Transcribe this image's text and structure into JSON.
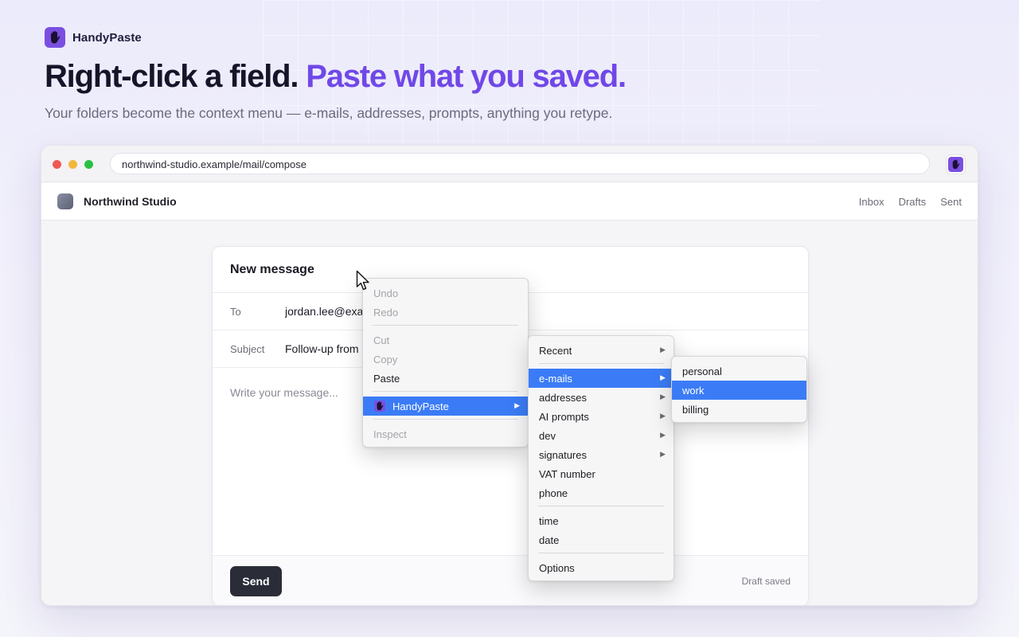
{
  "brand": {
    "name": "HandyPaste",
    "logo_icon": "hand-icon",
    "accent": "#7048e8"
  },
  "hero": {
    "headline_main": "Right-click a field.",
    "headline_accent": "Paste what you saved.",
    "subline": "Your folders become the context menu — e-mails, addresses, prompts, anything you retype."
  },
  "browser": {
    "url": "northwind-studio.example/mail/compose",
    "extension_icon": "handypaste-extension-icon"
  },
  "app": {
    "name": "Northwind Studio",
    "nav": [
      "Inbox",
      "Drafts",
      "Sent"
    ]
  },
  "compose": {
    "title": "New message",
    "to_label": "To",
    "to_value": "jordan.lee@exam",
    "subject_label": "Subject",
    "subject_value": "Follow-up from",
    "body_placeholder": "Write your message...",
    "send_label": "Send",
    "status": "Draft saved"
  },
  "context_menu": {
    "undo": "Undo",
    "redo": "Redo",
    "cut": "Cut",
    "copy": "Copy",
    "paste": "Paste",
    "handypaste": "HandyPaste",
    "inspect": "Inspect"
  },
  "handypaste_menu": {
    "recent": "Recent",
    "emails": "e-mails",
    "addresses": "addresses",
    "ai_prompts": "AI prompts",
    "dev": "dev",
    "signatures": "signatures",
    "vat": "VAT number",
    "phone": "phone",
    "time": "time",
    "date": "date",
    "options": "Options"
  },
  "emails_menu": {
    "personal": "personal",
    "work": "work",
    "billing": "billing"
  },
  "colors": {
    "selection": "#3b7cf6",
    "send_button": "#2a2d38"
  }
}
